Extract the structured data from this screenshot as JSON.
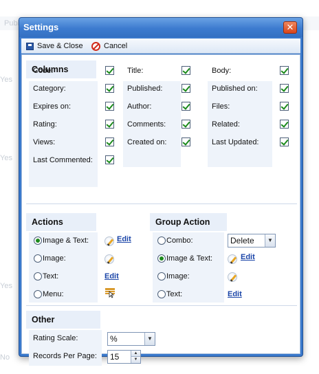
{
  "background": {
    "header_fragment": "Publ",
    "row_values": [
      "Yes",
      "Yes",
      "Yes",
      "Yes",
      "No"
    ]
  },
  "window": {
    "title": "Settings",
    "close_glyph": "✕"
  },
  "toolbar": {
    "save_close": "Save & Close",
    "cancel": "Cancel"
  },
  "columns": {
    "heading": "Columns",
    "items": [
      {
        "label": "Code:",
        "checked": true
      },
      {
        "label": "Title:",
        "checked": true
      },
      {
        "label": "Body:",
        "checked": true
      },
      {
        "label": "Category:",
        "checked": true
      },
      {
        "label": "Published:",
        "checked": true
      },
      {
        "label": "Published on:",
        "checked": true
      },
      {
        "label": "Expires on:",
        "checked": true
      },
      {
        "label": "Author:",
        "checked": true
      },
      {
        "label": "Files:",
        "checked": true
      },
      {
        "label": "Rating:",
        "checked": true
      },
      {
        "label": "Comments:",
        "checked": true
      },
      {
        "label": "Related:",
        "checked": true
      },
      {
        "label": "Views:",
        "checked": true
      },
      {
        "label": "Created on:",
        "checked": true
      },
      {
        "label": "Last Updated:",
        "checked": true
      },
      {
        "label": "Last Commented:",
        "checked": true
      }
    ]
  },
  "actions": {
    "heading": "Actions",
    "options": [
      {
        "label": "Image & Text:",
        "selected": true,
        "link": "Edit"
      },
      {
        "label": "Image:",
        "selected": false
      },
      {
        "label": "Text:",
        "selected": false,
        "link": "Edit"
      },
      {
        "label": "Menu:",
        "selected": false
      }
    ]
  },
  "group_action": {
    "heading": "Group Action",
    "options": [
      {
        "label": "Combo:",
        "selected": false,
        "value": "Delete"
      },
      {
        "label": "Image & Text:",
        "selected": true,
        "link": "Edit"
      },
      {
        "label": "Image:",
        "selected": false
      },
      {
        "label": "Text:",
        "selected": false,
        "link": "Edit"
      }
    ]
  },
  "other": {
    "heading": "Other",
    "rating_scale_label": "Rating Scale:",
    "rating_scale_value": "%",
    "records_per_page_label": "Records Per Page:",
    "records_per_page_value": "15"
  },
  "colors": {
    "window_blue": "#3a79cc",
    "section_bg": "#e8eff9",
    "check_green": "#1a8a1a",
    "link_blue": "#1b45a8",
    "close_red": "#d9451c"
  },
  "icons": {
    "save": "save-icon",
    "cancel": "cancel-icon",
    "pencil": "pencil-icon",
    "menu": "menu-icon",
    "close": "close-icon"
  }
}
